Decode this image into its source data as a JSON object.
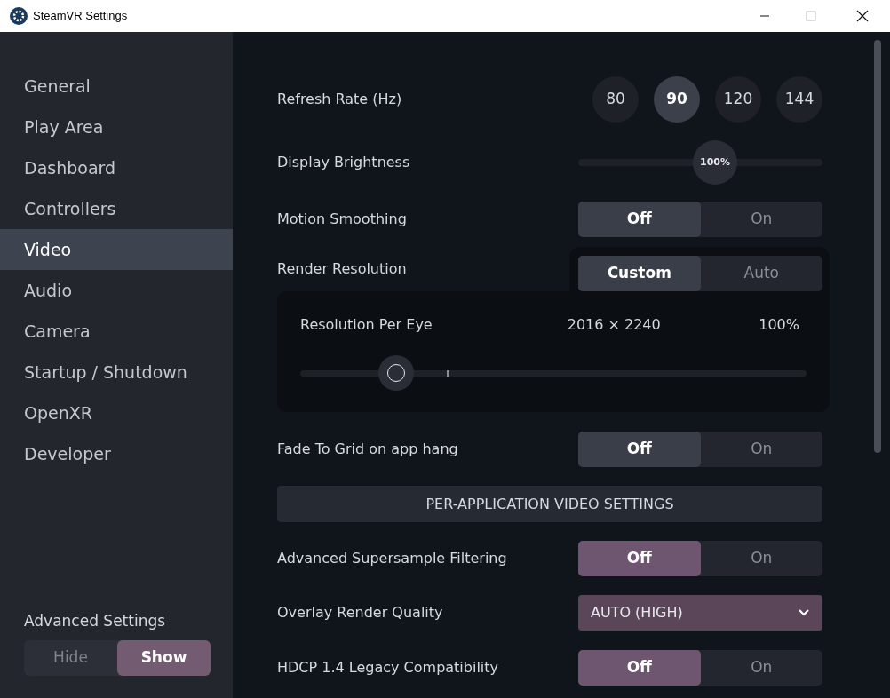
{
  "window": {
    "title": "SteamVR Settings"
  },
  "sidebar": {
    "items": [
      {
        "label": "General",
        "selected": false
      },
      {
        "label": "Play Area",
        "selected": false
      },
      {
        "label": "Dashboard",
        "selected": false
      },
      {
        "label": "Controllers",
        "selected": false
      },
      {
        "label": "Video",
        "selected": true
      },
      {
        "label": "Audio",
        "selected": false
      },
      {
        "label": "Camera",
        "selected": false
      },
      {
        "label": "Startup / Shutdown",
        "selected": false
      },
      {
        "label": "OpenXR",
        "selected": false
      },
      {
        "label": "Developer",
        "selected": false
      }
    ],
    "advanced_settings": {
      "label": "Advanced Settings",
      "options": [
        {
          "label": "Hide",
          "selected": false
        },
        {
          "label": "Show",
          "selected": true
        }
      ]
    }
  },
  "settings": [
    {
      "kind": "rates",
      "label": "Refresh Rate (Hz)",
      "options": [
        {
          "label": "80",
          "selected": false
        },
        {
          "label": "90",
          "selected": true
        },
        {
          "label": "120",
          "selected": false
        },
        {
          "label": "144",
          "selected": false
        }
      ]
    },
    {
      "kind": "slider",
      "label": "Display Brightness",
      "level": 0.56,
      "reading": "100%"
    },
    {
      "kind": "toggle",
      "label": "Motion Smoothing",
      "advanced": false,
      "options": [
        {
          "label": "Off",
          "selected": true
        },
        {
          "label": "On",
          "selected": false
        }
      ]
    },
    {
      "kind": "toggle",
      "label": "Render Resolution",
      "advanced": false,
      "options": [
        {
          "label": "Custom",
          "selected": true
        },
        {
          "label": "Auto",
          "selected": false
        }
      ],
      "detail": {
        "label": "Resolution Per Eye",
        "value": "2016 × 2240",
        "reading": "100%",
        "level": 0.19
      }
    },
    {
      "kind": "toggle",
      "label": "Fade To Grid on app hang",
      "advanced": false,
      "options": [
        {
          "label": "Off",
          "selected": true
        },
        {
          "label": "On",
          "selected": false
        }
      ]
    },
    {
      "kind": "button",
      "label": "PER-APPLICATION VIDEO SETTINGS"
    },
    {
      "kind": "toggle",
      "label": "Advanced Supersample Filtering",
      "advanced": true,
      "options": [
        {
          "label": "Off",
          "selected": true
        },
        {
          "label": "On",
          "selected": false
        }
      ]
    },
    {
      "kind": "dropdown",
      "label": "Overlay Render Quality",
      "advanced": true,
      "value": "AUTO (HIGH)"
    },
    {
      "kind": "toggle",
      "label": "HDCP 1.4 Legacy Compatibility",
      "advanced": true,
      "options": [
        {
          "label": "Off",
          "selected": true
        },
        {
          "label": "On",
          "selected": false
        }
      ]
    }
  ]
}
